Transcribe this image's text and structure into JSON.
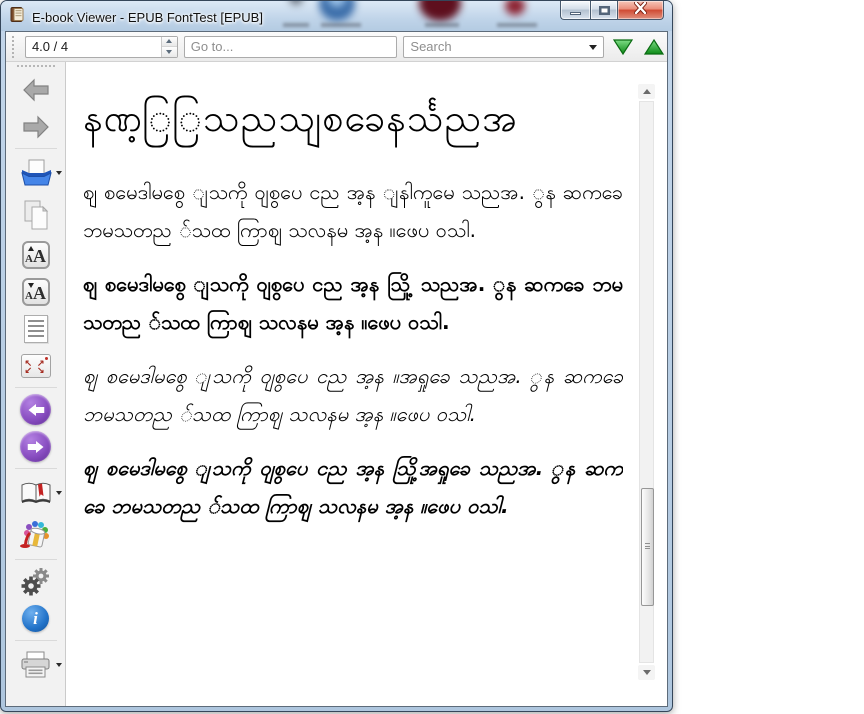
{
  "window": {
    "title": "E-book Viewer - EPUB FontTest [EPUB]",
    "app_icon": "book-icon",
    "buttons": [
      {
        "name": "minimize"
      },
      {
        "name": "maximize"
      },
      {
        "name": "close"
      }
    ]
  },
  "toolbar": {
    "page_position": "4.0 / 4",
    "goto_placeholder": "Go to...",
    "search_placeholder": "Search",
    "find_next_icon": "green-down-triangle",
    "find_previous_icon": "green-up-triangle"
  },
  "sidebar": {
    "icons": [
      "back-arrow",
      "forward-arrow",
      "open-ebook",
      "copy-to-clipboard",
      "font-size-larger",
      "font-size-smaller",
      "table-of-contents",
      "toggle-fullscreen",
      "previous-page",
      "next-page",
      "bookmark",
      "paint-bucket-themes",
      "preferences-gears",
      "book-info",
      "print"
    ],
    "font_icon_small": "A",
    "font_icon_large": "A",
    "info_glyph": "i"
  },
  "content": {
    "heading": "နဏ့ြြသညသျစခေနင်္သညအ",
    "paragraphs": [
      {
        "style": "regular",
        "text": "ဈ စမေဒါမစွေ ျသကို ဝျစွပေ ငည အ့န ျနါကူမေ သညအ. ွန ဆကခေ ဘမသတည ်သထ ကြာဈ သလနမ အ့န ။ဖေပ ဝသါ."
      },
      {
        "style": "bold",
        "text": "ဈ စမေဒါမစွေ ျသကို ဝျစွပေ ငည အ့န သြို့ သညအ. ွန ဆကခေ ဘမသတည ်သထ ကြာဈ သလနမ အ့န ။ဖေပ ဝသါ."
      },
      {
        "style": "italic",
        "text": "ဈ စမေဒါမစွေ ျသကို ဝျစွပေ ငည အ့န ။အရှုခေ သညအ. ွန ဆကခေ ဘမသတည ်သထ ကြာဈ သလနမ အ့န ။ဖေပ ဝသါ."
      },
      {
        "style": "bold-italic",
        "text": "ဈ စမေဒါမစွေ ျသကို ဝျစွပေ ငည အ့န သြို့အရှုခေ သညအ. ွန ဆကခေ ဘမသတည ်သထ ကြာဈ သလနမ အ့န ။ဖေပ ဝသါ."
      }
    ]
  },
  "colors": {
    "titlebar_glass": "#c7d9eb",
    "close_button_red": "#cf4a33",
    "search_arrow_green": "#1e9e2a",
    "nav_circle_purple": "#7b3fb5",
    "info_blue": "#1e6fc4",
    "fullscreen_arrow_red": "#a52d22",
    "bookmark_ribbon_red": "#c32222"
  }
}
